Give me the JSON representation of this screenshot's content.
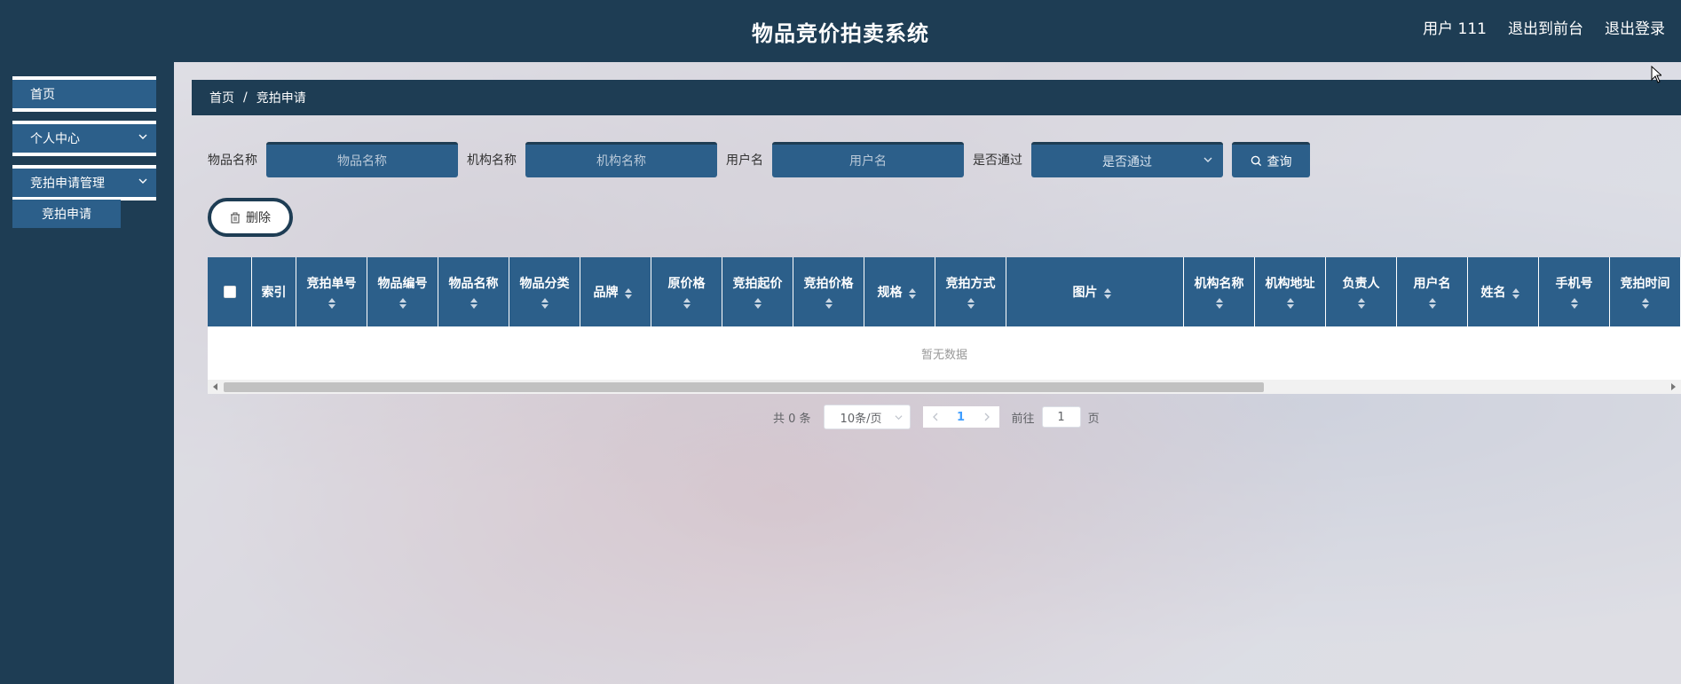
{
  "header": {
    "title": "物品竞价拍卖系统",
    "user_label": "用户 111",
    "front_label": "退出到前台",
    "logout_label": "退出登录"
  },
  "sidebar": {
    "items": [
      {
        "label": "首页"
      },
      {
        "label": "个人中心"
      },
      {
        "label": "竞拍申请管理"
      }
    ],
    "subitem": {
      "label": "竞拍申请"
    }
  },
  "breadcrumb": {
    "home": "首页",
    "separator": "/",
    "current": "竞拍申请"
  },
  "search": {
    "item_name_label": "物品名称",
    "item_name_placeholder": "物品名称",
    "org_name_label": "机构名称",
    "org_name_placeholder": "机构名称",
    "username_label": "用户名",
    "username_placeholder": "用户名",
    "passed_label": "是否通过",
    "passed_placeholder": "是否通过",
    "query_label": "查询"
  },
  "actions": {
    "delete_label": "删除"
  },
  "table": {
    "columns": [
      {
        "label": "索引"
      },
      {
        "label": "竞拍单号"
      },
      {
        "label": "物品编号"
      },
      {
        "label": "物品名称"
      },
      {
        "label": "物品分类"
      },
      {
        "label": "品牌"
      },
      {
        "label": "原价格"
      },
      {
        "label": "竞拍起价"
      },
      {
        "label": "竞拍价格"
      },
      {
        "label": "规格"
      },
      {
        "label": "竞拍方式"
      },
      {
        "label": "图片"
      },
      {
        "label": "机构名称"
      },
      {
        "label": "机构地址"
      },
      {
        "label": "负责人"
      },
      {
        "label": "用户名"
      },
      {
        "label": "姓名"
      },
      {
        "label": "手机号"
      },
      {
        "label": "竞拍时间"
      }
    ],
    "empty_text": "暂无数据"
  },
  "pagination": {
    "total_text": "共 0 条",
    "page_size": "10条/页",
    "current_page": "1",
    "goto_label": "前往",
    "goto_value": "1",
    "page_unit": "页"
  },
  "icons": {
    "chevron": "chevron-down-icon",
    "search": "search-icon",
    "trash": "trash-icon",
    "sort": "sort-icon"
  },
  "colors": {
    "primary_dark": "#1e3d54",
    "primary": "#2c5f8a",
    "accent_blue": "#409eff"
  }
}
